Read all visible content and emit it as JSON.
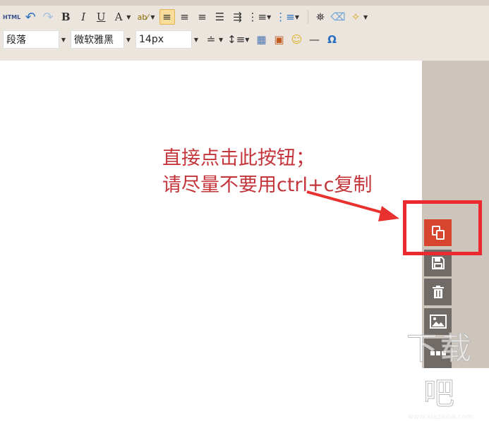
{
  "toolbar": {
    "html_label": "HTML",
    "bold": "B",
    "italic": "I",
    "underline": "U",
    "font_color": "A",
    "paragraph": "段落",
    "font_family": "微软雅黑",
    "font_size": "14px",
    "omega": "Ω"
  },
  "annotation": {
    "line1": "直接点击此按钮；",
    "line2": "请尽量不要用ctrl+c复制",
    "color": "#c4353b"
  },
  "watermark": {
    "logo": "下载吧",
    "url": "www.xiazaiba.com"
  },
  "colors": {
    "accent": "#d8452f",
    "highlight": "#ea2a2e",
    "float_btn": "#716b67"
  }
}
